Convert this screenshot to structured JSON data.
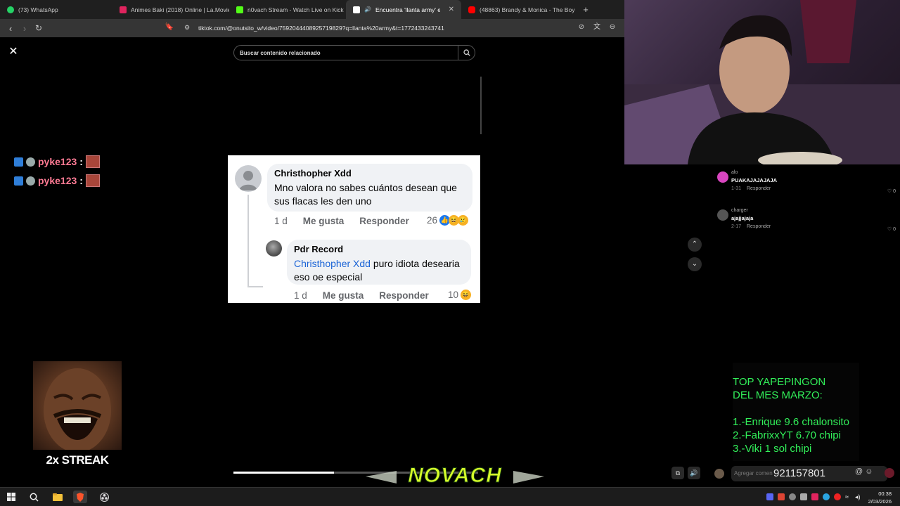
{
  "browser": {
    "tabs": [
      {
        "title": "(73) WhatsApp",
        "favicon_color": "#25d366",
        "active": false
      },
      {
        "title": "Animes Baki (2018) Online | La.Movie",
        "favicon_color": "#e0245e",
        "active": false
      },
      {
        "title": "n0vach Stream - Watch Live on Kick",
        "favicon_color": "#53fc18",
        "active": false
      },
      {
        "title": "Encuentra 'llanta army' en Ti",
        "favicon_color": "#ffffff",
        "active": true
      },
      {
        "title": "(48863) Brandy & Monica - The Boy",
        "favicon_color": "#ff0000",
        "active": false
      }
    ],
    "new_tab_label": "+",
    "url": "tiktok.com/@onutsito_w/video/7592044408925719829?q=llanta%20army&t=1772433243741"
  },
  "tiktok": {
    "search_placeholder": "Buscar contenido relacionado",
    "progress_fraction": 0.41
  },
  "facebook_comments": {
    "main": {
      "name": "Christhopher Xdd",
      "text": "Mno valora no sabes cuántos desean que sus flacas les den uno",
      "time": "1 d",
      "like_label": "Me gusta",
      "reply_label": "Responder",
      "reaction_count": "26"
    },
    "reply": {
      "name": "Pdr Record",
      "mention": "Christhopher Xdd",
      "text": " puro idiota desearia eso oe especial",
      "time": "1 d",
      "like_label": "Me gusta",
      "reply_label": "Responder",
      "reaction_count": "10"
    }
  },
  "stream_chat": [
    {
      "user": "pyke123",
      "colon": ":"
    },
    {
      "user": "pyke123",
      "colon": ":"
    }
  ],
  "streak_label": "2x STREAK",
  "right_comments": [
    {
      "user": "alo",
      "text": "PUAKAJAJAJAJA",
      "date": "1-31",
      "reply": "Responder",
      "likes": "♡ 0",
      "avatar_color": "#d946c0"
    },
    {
      "user": "charger",
      "text": "ajajjajaja",
      "date": "2-17",
      "reply": "Responder",
      "likes": "♡ 0",
      "avatar_color": "#555555"
    }
  ],
  "top_box": {
    "line1": "TOP YAPEPINGON",
    "line2": "DEL MES MARZO:",
    "item1": "1.-Enrique 9.6 chalonsito",
    "item2": "2.-FabrixxYT 6.70 chipi",
    "item3": "3.-Viki 1 sol chipi"
  },
  "comment_bar": {
    "placeholder": "Agregar comen",
    "phone": "921157801"
  },
  "watermark": "NOVACH",
  "taskbar": {
    "time": "00:38",
    "date": "2/03/2026"
  }
}
